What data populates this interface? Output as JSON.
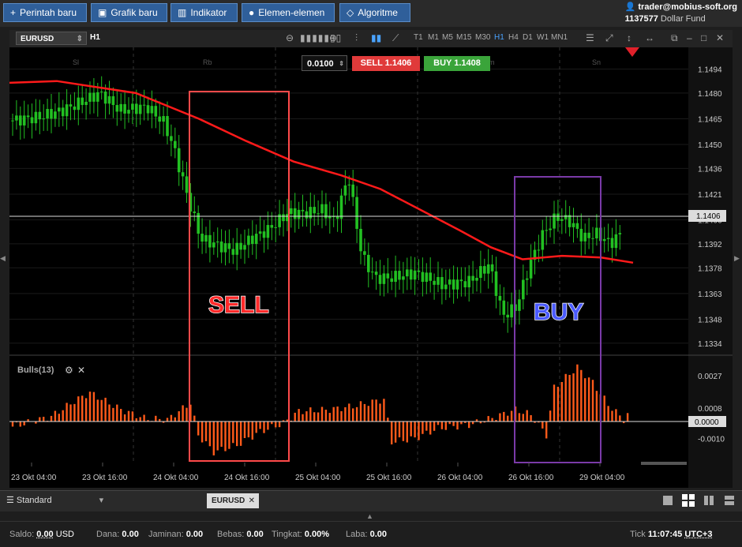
{
  "toolbar": {
    "new_order": "Perintah baru",
    "new_chart": "Grafik baru",
    "indicators": "Indikator",
    "elements": "Elemen-elemen",
    "algorithm": "Algoritme"
  },
  "account": {
    "user": "trader@mobius-soft.org",
    "number": "1137577",
    "fund": "Dollar Fund"
  },
  "chart": {
    "symbol": "EURUSD",
    "period": "H1",
    "timeframes": [
      "T1",
      "M1",
      "M5",
      "M15",
      "M30",
      "H1",
      "H4",
      "D1",
      "W1",
      "MN1"
    ],
    "active_timeframe": "H1",
    "lot": "0.0100",
    "sell_label": "SELL",
    "sell_price": "1.1406",
    "buy_label": "BUY",
    "buy_price": "1.1408",
    "days_top": [
      "Sl",
      "Rb",
      "m",
      "Sn"
    ],
    "sell_annotation": "SELL",
    "buy_annotation": "BUY",
    "indicator_label": "Bulls(13)"
  },
  "chart_data": {
    "type": "candlestick",
    "price_ticks": [
      "1.1494",
      "1.1480",
      "1.1465",
      "1.1450",
      "1.1436",
      "1.1421",
      "1.1406",
      "1.1392",
      "1.1378",
      "1.1363",
      "1.1348",
      "1.1334"
    ],
    "current_price": "1.1406",
    "ylim": [
      1.1327,
      1.1503
    ],
    "indicator_ticks": [
      "0.0027",
      "0.0008",
      "0.0000",
      "-0.0010"
    ],
    "indicator_current": "0.0000",
    "x_ticks": [
      "23 Okt 04:00",
      "23 Okt 16:00",
      "24 Okt 04:00",
      "24 Okt 16:00",
      "25 Okt 04:00",
      "25 Okt 16:00",
      "26 Okt 04:00",
      "26 Okt 16:00",
      "29 Okt 04:00"
    ],
    "colors": {
      "up": "#22c022",
      "down": "#22c022",
      "ma": "#ff1a1a",
      "bulls": "#ff5a1a",
      "sell_box": "#ff4a4a",
      "buy_box": "#7a3aa8"
    }
  },
  "bottom": {
    "layout": "Standard",
    "tab": "EURUSD"
  },
  "status": {
    "saldo_label": "Saldo:",
    "saldo": "0.00",
    "saldo_cur": "USD",
    "dana_label": "Dana:",
    "dana": "0.00",
    "jaminan_label": "Jaminan:",
    "jaminan": "0.00",
    "bebas_label": "Bebas:",
    "bebas": "0.00",
    "tingkat_label": "Tingkat:",
    "tingkat": "0.00%",
    "laba_label": "Laba:",
    "laba": "0.00",
    "tick_label": "Tick",
    "time": "11:07:45",
    "tz": "UTC+3"
  }
}
